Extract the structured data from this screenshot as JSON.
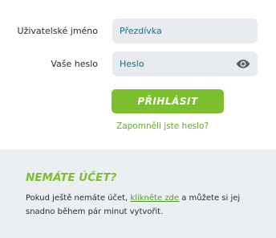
{
  "login": {
    "username_label": "Uživatelské jméno",
    "username_placeholder": "Přezdívka",
    "password_label": "Vaše heslo",
    "password_placeholder": "Heslo",
    "submit_label": "PŘIHLÁSIT",
    "forgot_label": "Zapomněli jste heslo?",
    "accent_color": "#7cbf2f"
  },
  "register": {
    "heading": "NEMÁTE ÚČET?",
    "text_before": "Pokud ještě nemáte účet, ",
    "link_label": "klikněte zde",
    "text_after": " a můžete si jej snadno během pár minut vytvořit."
  },
  "icons": {
    "password_toggle": "eye-icon"
  }
}
